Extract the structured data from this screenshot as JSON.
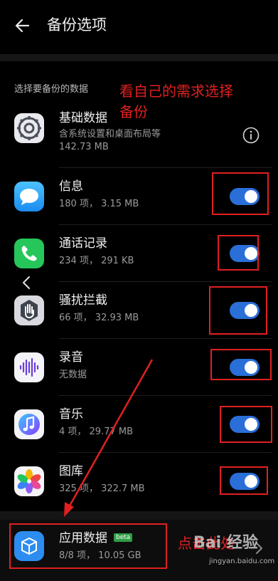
{
  "header": {
    "title": "备份选项"
  },
  "section_label": "选择要备份的数据",
  "rows": [
    {
      "name": "基础数据",
      "sub1": "含系统设置和桌面布局等",
      "sub2": "142.73 MB",
      "control": "info"
    },
    {
      "name": "信息",
      "sub": "180 项， 3.15 MB",
      "control": "toggle",
      "enabled": true
    },
    {
      "name": "通话记录",
      "sub": "234 项， 291 KB",
      "control": "toggle",
      "enabled": true
    },
    {
      "name": "骚扰拦截",
      "sub": "66 项， 32.93 MB",
      "control": "toggle",
      "enabled": true
    },
    {
      "name": "录音",
      "sub": "无数据",
      "control": "toggle",
      "enabled": true
    },
    {
      "name": "音乐",
      "sub": "4 项， 29.77 MB",
      "control": "toggle",
      "enabled": true
    },
    {
      "name": "图库",
      "sub": "325 项， 322.7 MB",
      "control": "toggle",
      "enabled": true
    }
  ],
  "app_data": {
    "name": "应用数据",
    "badge": "beta",
    "sub": "8/8 项， 10.05 GB"
  },
  "annotations": {
    "select_hint_line1": "看自己的需求选择",
    "select_hint_line2": "备份",
    "click_hint": "点击此处"
  },
  "watermark": {
    "brand": "Bai 经验",
    "url": "jingyan.baidu.com"
  },
  "colors": {
    "accent": "#2a6fd8",
    "annotation": "#e02020",
    "background": "#000000"
  }
}
